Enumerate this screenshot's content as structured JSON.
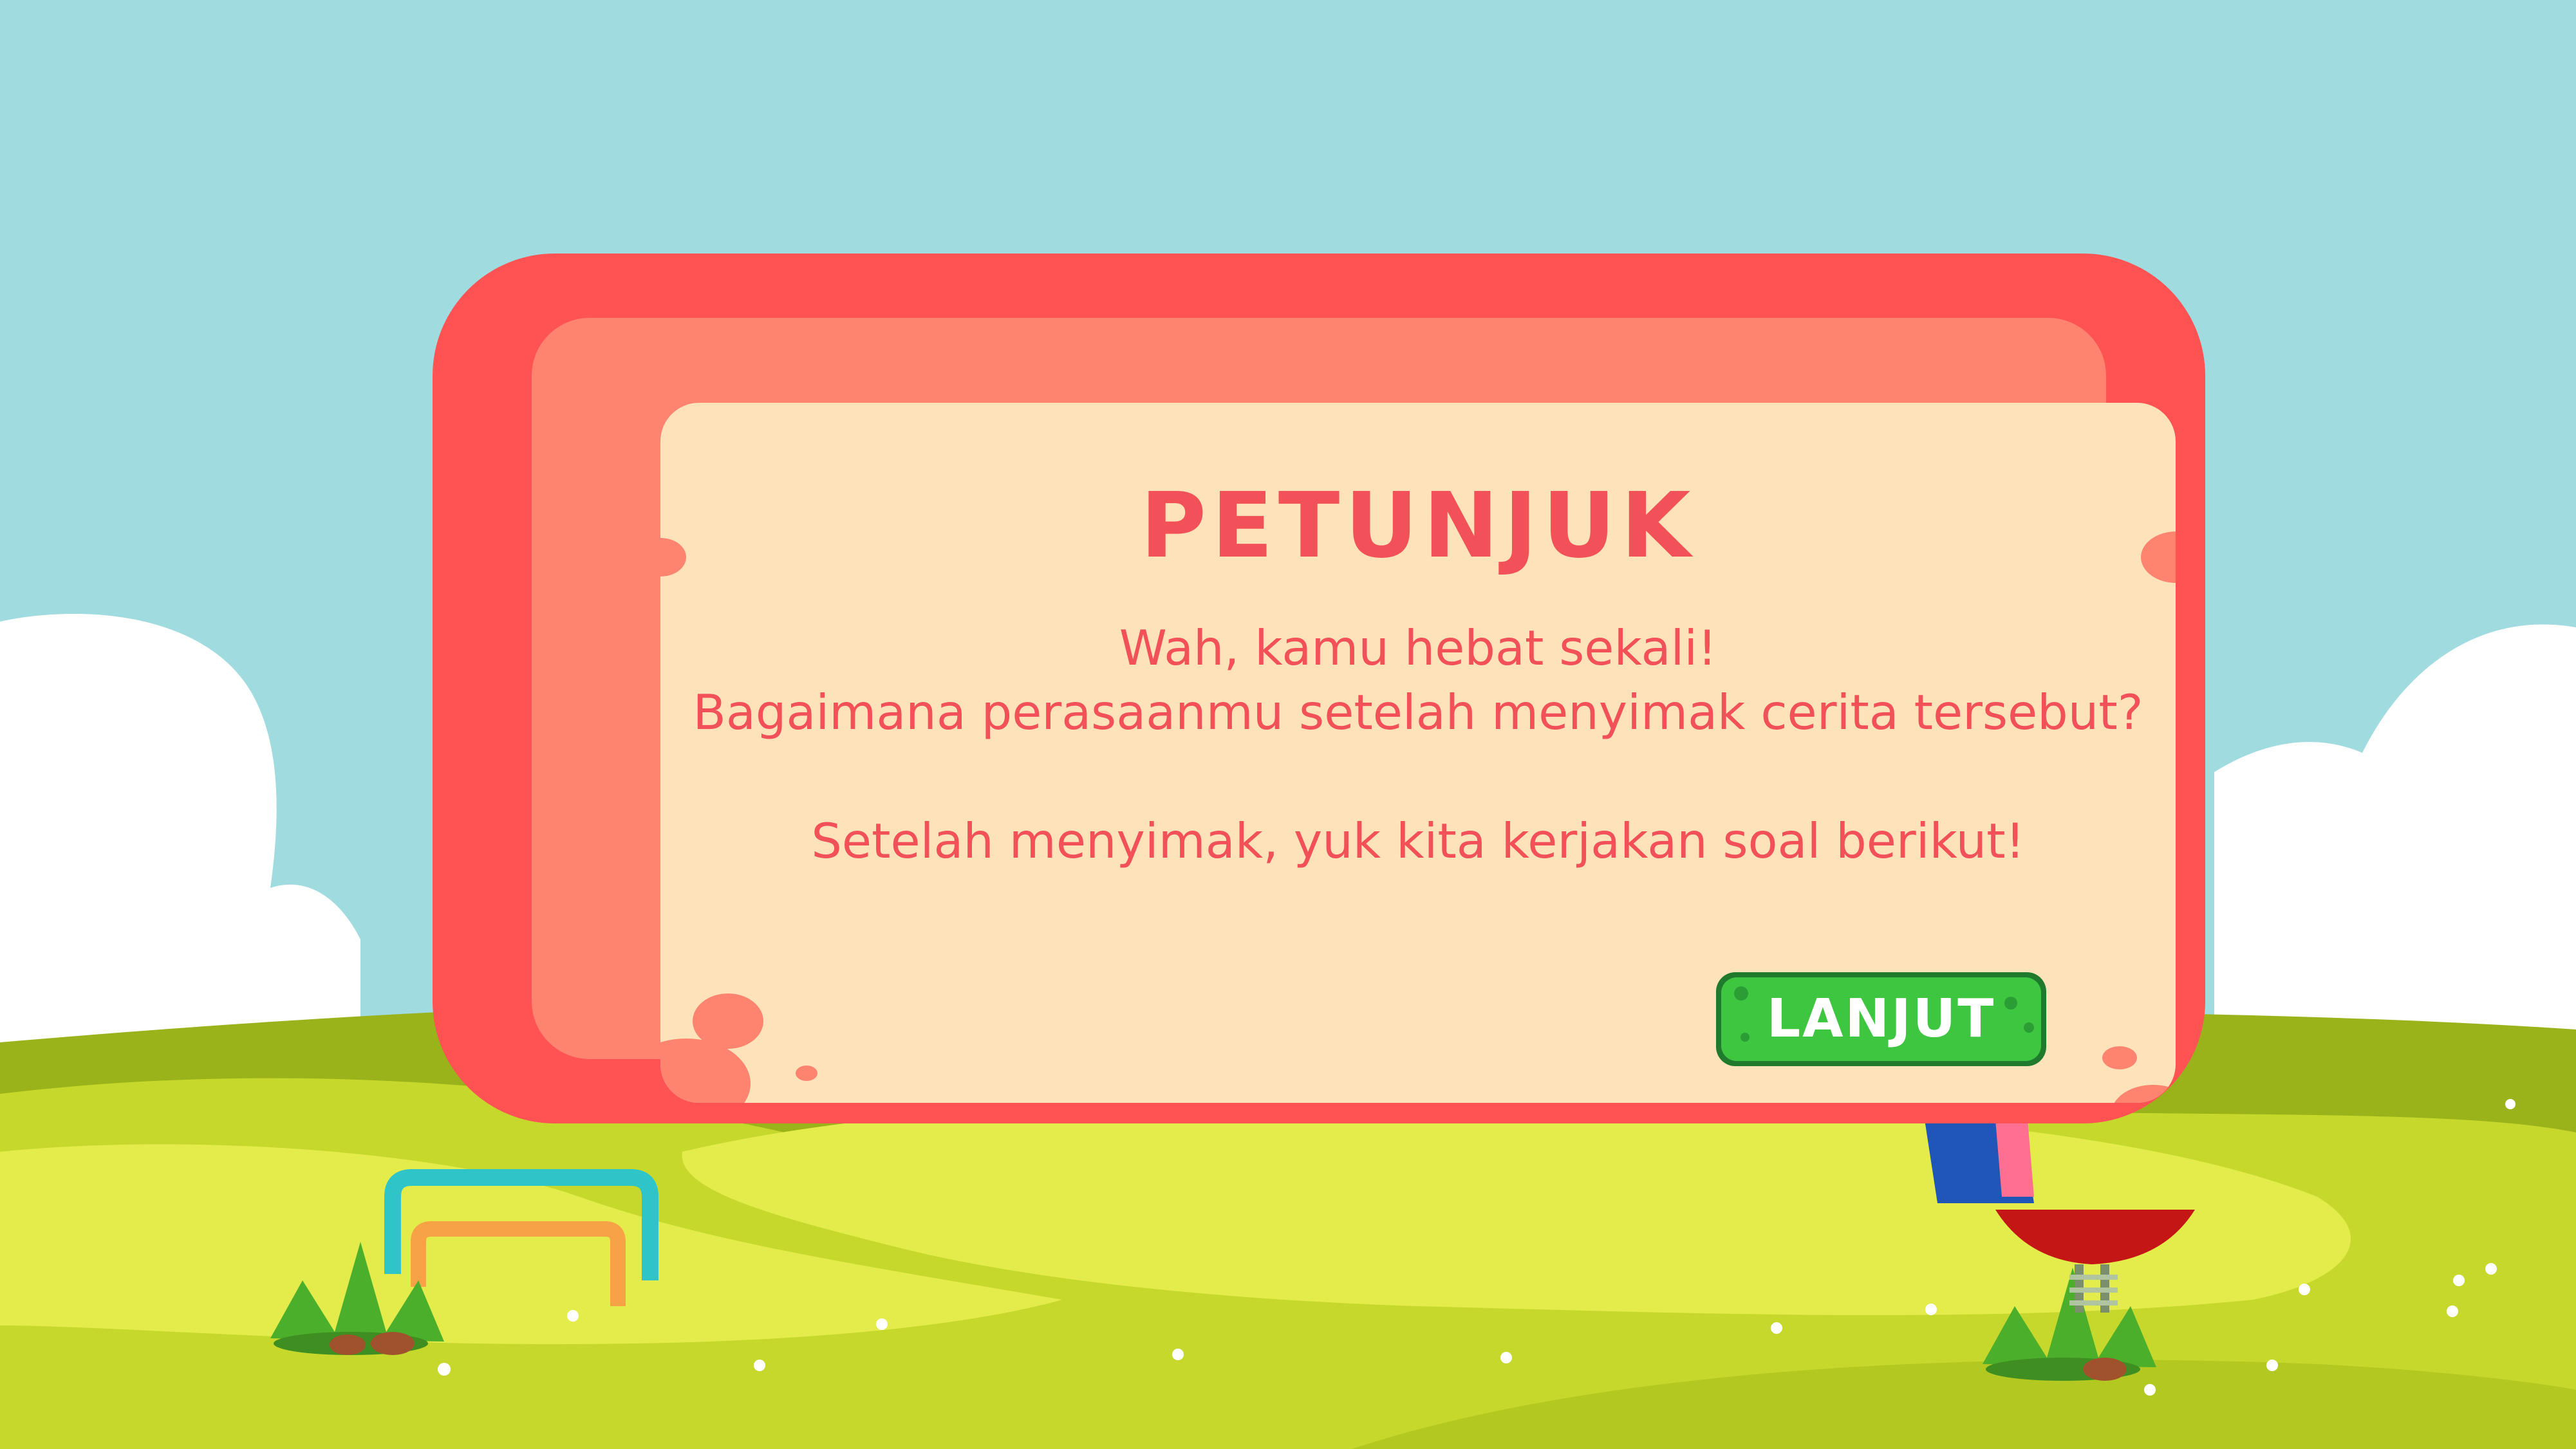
{
  "panel": {
    "title": "PETUNJUK",
    "line1": "Wah, kamu hebat sekali!",
    "line2": "Bagaimana perasaanmu setelah menyimak cerita tersebut?",
    "line3": "Setelah menyimak, yuk kita kerjakan soal berikut!"
  },
  "button": {
    "label": "LANJUT"
  },
  "colors": {
    "sky": "#a0dbe0",
    "cloud": "#ffffff",
    "grass_dark": "#9bb31a",
    "grass_mid": "#c6d82c",
    "grass_light": "#e3ec4a",
    "panel_outer": "#ff5252",
    "panel_mid": "#ff8470",
    "panel_inner": "#fee3ba",
    "text": "#f2515a",
    "button": "#3ec640"
  }
}
